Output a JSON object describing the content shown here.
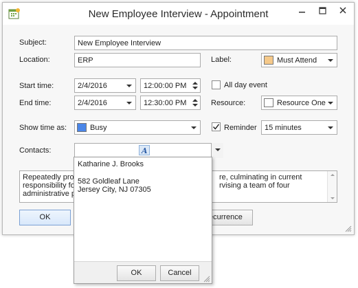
{
  "window": {
    "title": "New Employee Interview  - Appointment",
    "icon": "calendar-icon"
  },
  "form": {
    "subject_label": "Subject:",
    "subject_value": "New Employee Interview",
    "location_label": "Location:",
    "location_value": "ERP",
    "label_label": "Label:",
    "label_value": "Must Attend",
    "label_color": "#f5c98a",
    "start_label": "Start time:",
    "start_date": "2/4/2016",
    "start_time": "12:00:00 PM",
    "all_day_label": "All day event",
    "all_day_checked": false,
    "end_label": "End time:",
    "end_date": "2/4/2016",
    "end_time": "12:30:00 PM",
    "resource_label": "Resource:",
    "resource_value": "Resource One",
    "resource_color": "#ffffff",
    "show_time_label": "Show time as:",
    "show_time_value": "Busy",
    "show_time_color": "#4a86e8",
    "reminder_label": "Reminder",
    "reminder_checked": true,
    "reminder_value": "15 minutes",
    "contacts_label": "Contacts:",
    "contacts_value": "",
    "description_line1": "Repeatedly prom",
    "description_line1_end": "re, culminating in current",
    "description_line2": "responsibility fo",
    "description_line2_end": "rvising a team of four",
    "description_line3": "administrative p",
    "ok_label": "OK",
    "recurrence_label": "ecurrence"
  },
  "popup": {
    "name": "Katharine J. Brooks",
    "address_line1": "582 Goldleaf Lane",
    "address_line2": "Jersey City, NJ 07305",
    "ok_label": "OK",
    "cancel_label": "Cancel"
  }
}
